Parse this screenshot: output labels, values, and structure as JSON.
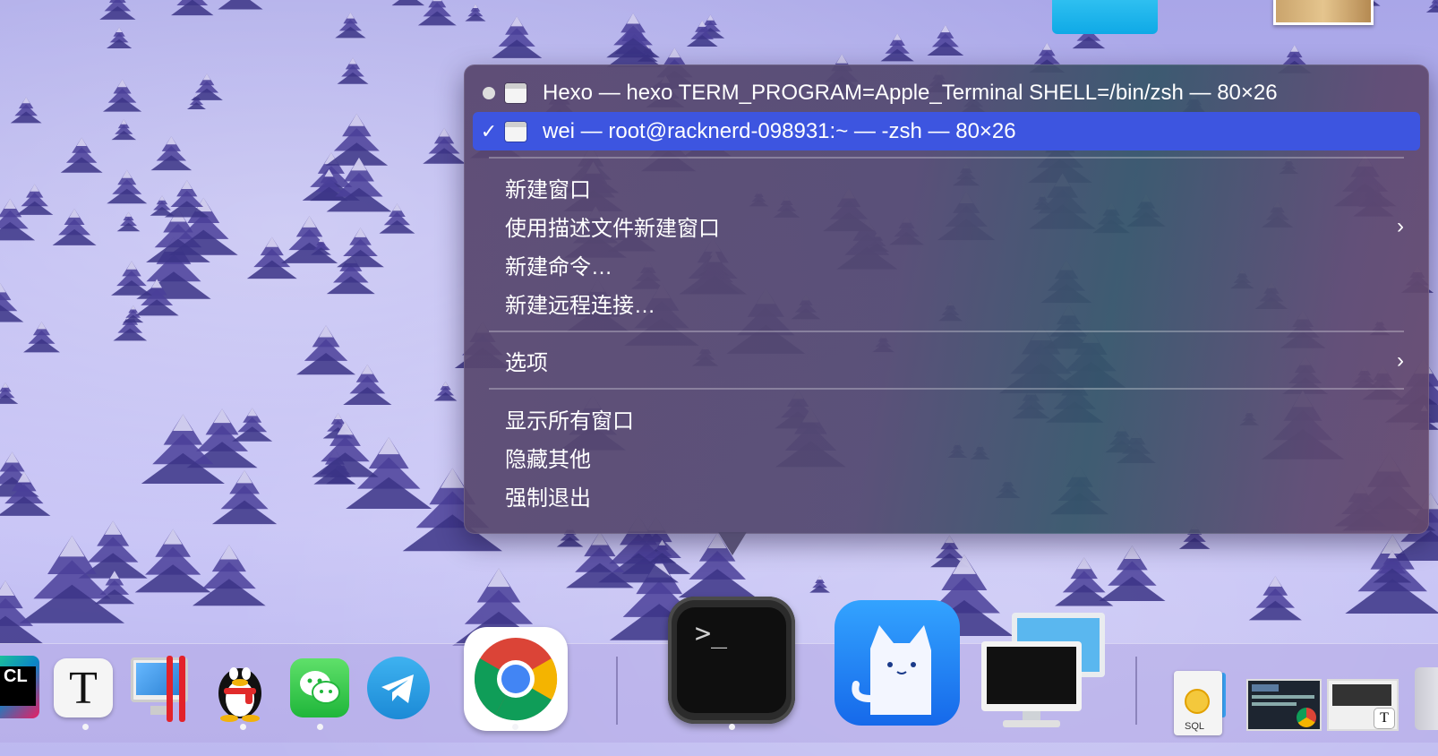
{
  "menu": {
    "windows": [
      {
        "label": "Hexo — hexo TERM_PROGRAM=Apple_Terminal SHELL=/bin/zsh — 80×26",
        "state": "dot"
      },
      {
        "label": "wei — root@racknerd-098931:~ — -zsh — 80×26",
        "state": "check",
        "selected": true
      }
    ],
    "new_window": "新建窗口",
    "new_window_with_profile": "使用描述文件新建窗口",
    "new_command": "新建命令…",
    "new_remote_connection": "新建远程连接…",
    "options": "选项",
    "show_all_windows": "显示所有窗口",
    "hide_others": "隐藏其他",
    "force_quit": "强制退出",
    "submenu_arrow": "›",
    "check_mark": "✓"
  },
  "dock": {
    "apps": [
      {
        "name": "CLion",
        "icon_text": "CL",
        "running": false
      },
      {
        "name": "Typora",
        "icon_text": "T",
        "running": true
      },
      {
        "name": "Parallels Desktop",
        "running": false
      },
      {
        "name": "QQ",
        "running": true
      },
      {
        "name": "WeChat",
        "running": true
      },
      {
        "name": "Telegram",
        "running": false
      },
      {
        "name": "Google Chrome",
        "running": true
      },
      {
        "name": "Terminal",
        "icon_text": ">_",
        "running": true
      },
      {
        "name": "Cat app",
        "running": false
      },
      {
        "name": "Screen Sharing",
        "running": false
      }
    ],
    "recents": [
      {
        "name": "SQL document",
        "icon_text": "SQL"
      },
      {
        "name": "Screenshot Chrome"
      },
      {
        "name": "Screenshot Typora",
        "icon_text": "T"
      },
      {
        "name": "Trash"
      }
    ]
  }
}
